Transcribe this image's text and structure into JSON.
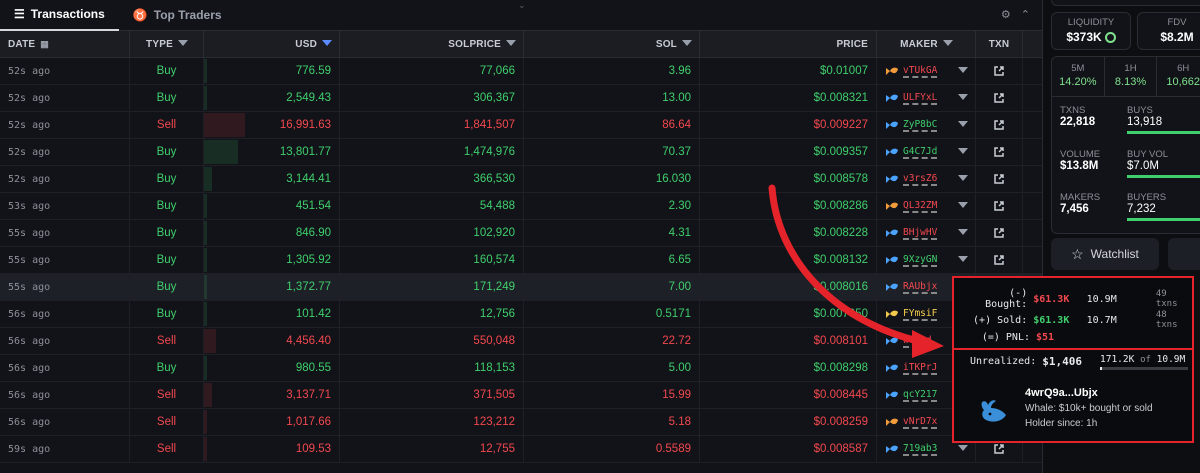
{
  "tabs": {
    "transactions": "Transactions",
    "top_traders": "Top Traders"
  },
  "columns": {
    "date": "DATE",
    "type": "TYPE",
    "usd": "USD",
    "solprice": "SOLPRICE",
    "sol": "SOL",
    "price": "PRICE",
    "maker": "MAKER",
    "txn": "TXN"
  },
  "rows": [
    {
      "date": "52s ago",
      "type": "Buy",
      "usd": "776.59",
      "solprice": "77,066",
      "sol": "3.96",
      "price": "$0.01007",
      "maker": "vTUkGA",
      "bar": 0.02
    },
    {
      "date": "52s ago",
      "type": "Buy",
      "usd": "2,549.43",
      "solprice": "306,367",
      "sol": "13.00",
      "price": "$0.008321",
      "maker": "ULFYxL",
      "bar": 0.02
    },
    {
      "date": "52s ago",
      "type": "Sell",
      "usd": "16,991.63",
      "solprice": "1,841,507",
      "sol": "86.64",
      "price": "$0.009227",
      "maker": "ZyP8bC",
      "bar": 0.3
    },
    {
      "date": "52s ago",
      "type": "Buy",
      "usd": "13,801.77",
      "solprice": "1,474,976",
      "sol": "70.37",
      "price": "$0.009357",
      "maker": "G4C7Jd",
      "bar": 0.25
    },
    {
      "date": "52s ago",
      "type": "Buy",
      "usd": "3,144.41",
      "solprice": "366,530",
      "sol": "16.030",
      "price": "$0.008578",
      "maker": "v3rsZ6",
      "bar": 0.06
    },
    {
      "date": "53s ago",
      "type": "Buy",
      "usd": "451.54",
      "solprice": "54,488",
      "sol": "2.30",
      "price": "$0.008286",
      "maker": "QL32ZM",
      "bar": 0.02
    },
    {
      "date": "55s ago",
      "type": "Buy",
      "usd": "846.90",
      "solprice": "102,920",
      "sol": "4.31",
      "price": "$0.008228",
      "maker": "BHjwHV",
      "bar": 0.02
    },
    {
      "date": "55s ago",
      "type": "Buy",
      "usd": "1,305.92",
      "solprice": "160,574",
      "sol": "6.65",
      "price": "$0.008132",
      "maker": "9XzyGN",
      "bar": 0.02
    },
    {
      "date": "55s ago",
      "type": "Buy",
      "usd": "1,372.77",
      "solprice": "171,249",
      "sol": "7.00",
      "price": "$0.008016",
      "maker": "RAUbjx",
      "bar": 0.02
    },
    {
      "date": "56s ago",
      "type": "Buy",
      "usd": "101.42",
      "solprice": "12,756",
      "sol": "0.5171",
      "price": "$0.007950",
      "maker": "FYmsiF",
      "bar": 0.02
    },
    {
      "date": "56s ago",
      "type": "Sell",
      "usd": "4,456.40",
      "solprice": "550,048",
      "sol": "22.72",
      "price": "$0.008101",
      "maker": "wfrQd",
      "bar": 0.09
    },
    {
      "date": "56s ago",
      "type": "Buy",
      "usd": "980.55",
      "solprice": "118,153",
      "sol": "5.00",
      "price": "$0.008298",
      "maker": "iTKPrJ",
      "bar": 0.02
    },
    {
      "date": "56s ago",
      "type": "Sell",
      "usd": "3,137.71",
      "solprice": "371,505",
      "sol": "15.99",
      "price": "$0.008445",
      "maker": "qcY217",
      "bar": 0.06
    },
    {
      "date": "56s ago",
      "type": "Sell",
      "usd": "1,017.66",
      "solprice": "123,212",
      "sol": "5.18",
      "price": "$0.008259",
      "maker": "vNrD7x",
      "bar": 0.02
    },
    {
      "date": "59s ago",
      "type": "Sell",
      "usd": "109.53",
      "solprice": "12,755",
      "sol": "0.5589",
      "price": "$0.008587",
      "maker": "719ab3",
      "bar": 0.02
    }
  ],
  "side": {
    "liquidity_label": "LIQUIDITY",
    "liquidity": "$373K",
    "fdv_label": "FDV",
    "fdv": "$8.2M",
    "tf": [
      {
        "label": "5M",
        "val": "14.20%"
      },
      {
        "label": "1H",
        "val": "8.13%"
      },
      {
        "label": "6H",
        "val": "10,662"
      }
    ],
    "txns_label": "TXNS",
    "txns": "22,818",
    "buys_label": "BUYS",
    "buys": "13,918",
    "volume_label": "VOLUME",
    "volume": "$13.8M",
    "buyvol_label": "BUY VOL",
    "buyvol": "$7.0M",
    "makers_label": "MAKERS",
    "makers": "7,456",
    "buyers_label": "BUYERS",
    "buyers": "7,232",
    "watchlist": "Watchlist"
  },
  "tooltip": {
    "bought_label": "(-) Bought:",
    "bought_usd": "$61.3K",
    "bought_tok": "10.9M",
    "bought_txns": "49 txns",
    "sold_label": "(+) Sold:",
    "sold_usd": "$61.3K",
    "sold_tok": "10.7M",
    "sold_txns": "48 txns",
    "pnl_label": "(=) PNL:",
    "pnl": "$51",
    "unrealized_label": "Unrealized:",
    "unrealized": "$1,406",
    "holding": "171.2K",
    "of": "of",
    "holding_total": "10.9M",
    "holding_fraction": 0.016,
    "address": "4wrQ9a...Ubjx",
    "whale": "Whale: $10k+ bought or sold",
    "holder_since": "Holder since: 1h"
  },
  "colors": {
    "buy": "#3fcf6d",
    "sell": "#f2484f",
    "highlight": "#e4232a"
  }
}
